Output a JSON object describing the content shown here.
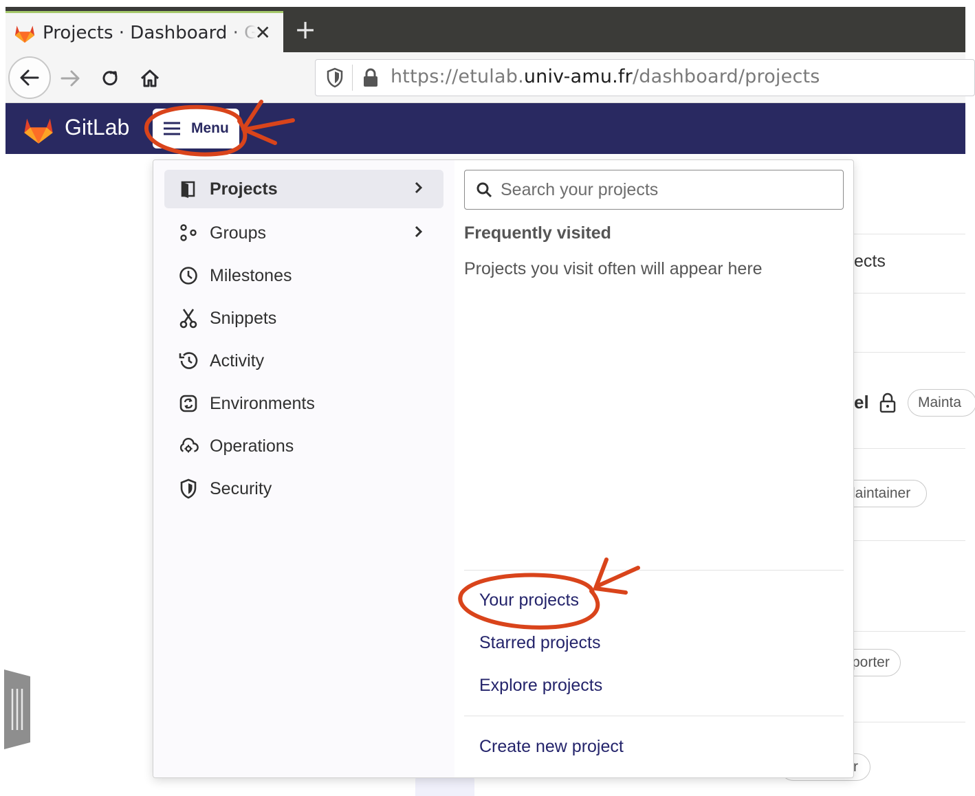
{
  "browser": {
    "tab_title": "Projects · Dashboard · GitLab",
    "url_prefix": "https://etulab.",
    "url_host": "univ-amu.fr",
    "url_path": "/dashboard/projects"
  },
  "gitlab": {
    "brand": "GitLab",
    "menu_label": "Menu"
  },
  "menu": {
    "items": [
      {
        "label": "Projects",
        "icon": "project-icon"
      },
      {
        "label": "Groups",
        "icon": "group-icon"
      },
      {
        "label": "Milestones",
        "icon": "clock-icon"
      },
      {
        "label": "Snippets",
        "icon": "snippet-icon"
      },
      {
        "label": "Activity",
        "icon": "history-icon"
      },
      {
        "label": "Environments",
        "icon": "environment-icon"
      },
      {
        "label": "Operations",
        "icon": "cloud-gear-icon"
      },
      {
        "label": "Security",
        "icon": "shield-icon"
      }
    ],
    "search_placeholder": "Search your projects",
    "frequently_visited": "Frequently visited",
    "frequently_empty": "Projects you visit often will appear here",
    "links": {
      "your_projects": "Your projects",
      "starred_projects": "Starred projects",
      "explore_projects": "Explore projects",
      "create_new_project": "Create new project"
    }
  },
  "background": {
    "heading_fragment": "ects",
    "project_fragment": "el",
    "role_pills": [
      "Mainta",
      "laintainer",
      "porter",
      "r"
    ]
  },
  "colors": {
    "header_bg": "#292961",
    "annotation": "#d9441b",
    "link": "#24246b"
  }
}
